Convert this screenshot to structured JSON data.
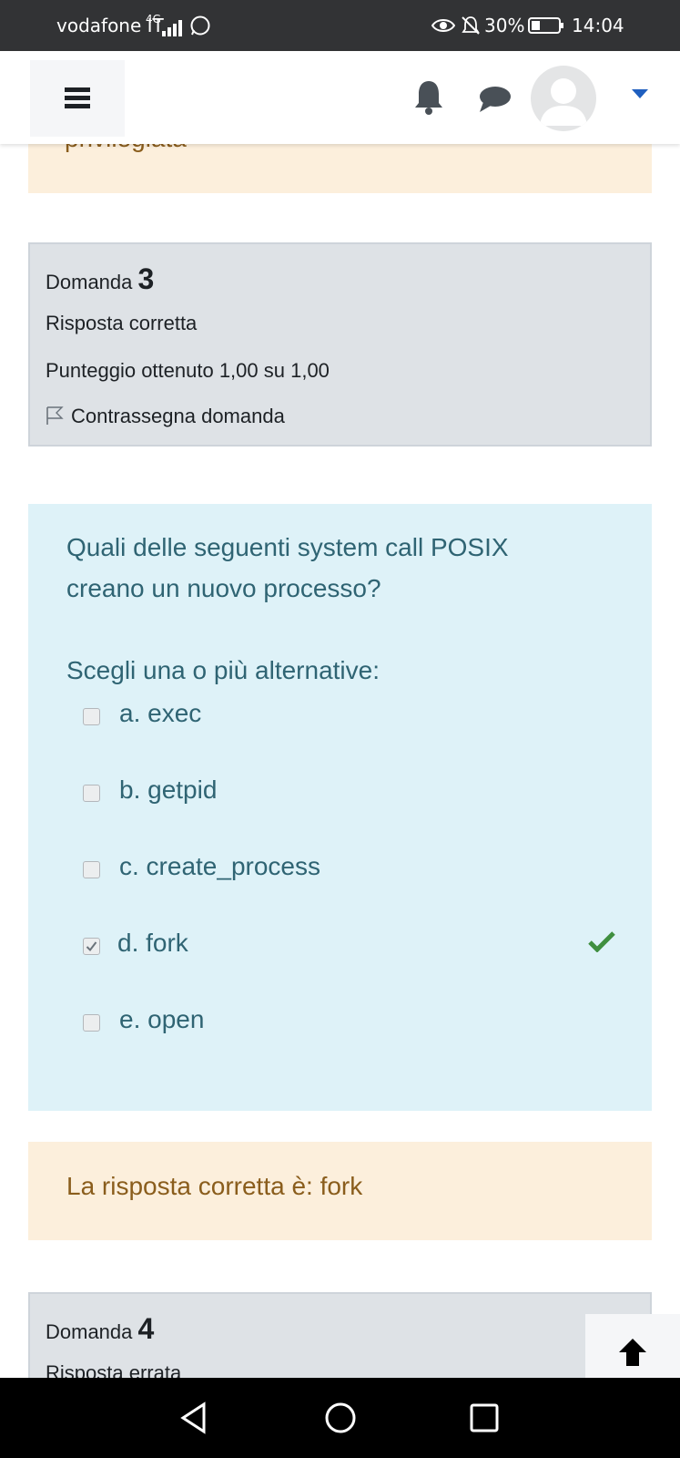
{
  "status": {
    "carrier": "vodafone IT",
    "network": "4G",
    "battery": "30%",
    "time": "14:04"
  },
  "icons": {
    "menu": "hamburger-icon",
    "bell": "bell-icon",
    "chat": "chat-icon",
    "avatar": "user-avatar-icon",
    "dropdown": "caret-down-icon",
    "flag": "flag-icon",
    "check": "checkmark-icon",
    "up": "arrow-up-icon"
  },
  "prev_feedback_fragment": "privilegiata",
  "q3": {
    "label": "Domanda",
    "number": "3",
    "state": "Risposta corretta",
    "grade": "Punteggio ottenuto 1,00 su 1,00",
    "flag": "Contrassegna domanda"
  },
  "question": {
    "text_line1": "Quali delle seguenti system call POSIX",
    "text_line2": "creano un nuovo processo?",
    "prompt": "Scegli una o più alternative:",
    "options": [
      {
        "label": "a. exec",
        "checked": false
      },
      {
        "label": "b. getpid",
        "checked": false
      },
      {
        "label": "c. create_process",
        "checked": false
      },
      {
        "label": "d. fork",
        "checked": true
      },
      {
        "label": "e. open",
        "checked": false
      }
    ]
  },
  "feedback": "La risposta corretta è: fork",
  "q4": {
    "label": "Domanda",
    "number": "4",
    "state": "Risposta errata"
  },
  "colors": {
    "statusbar": "#323335",
    "info_bg": "#dee2e6",
    "warn_bg": "#fcefdc",
    "question_bg": "#def2f8",
    "question_text": "#2f6473",
    "feedback_text": "#8a5d1c",
    "correct": "#3f8f3f",
    "accent": "#1f5fbf"
  }
}
